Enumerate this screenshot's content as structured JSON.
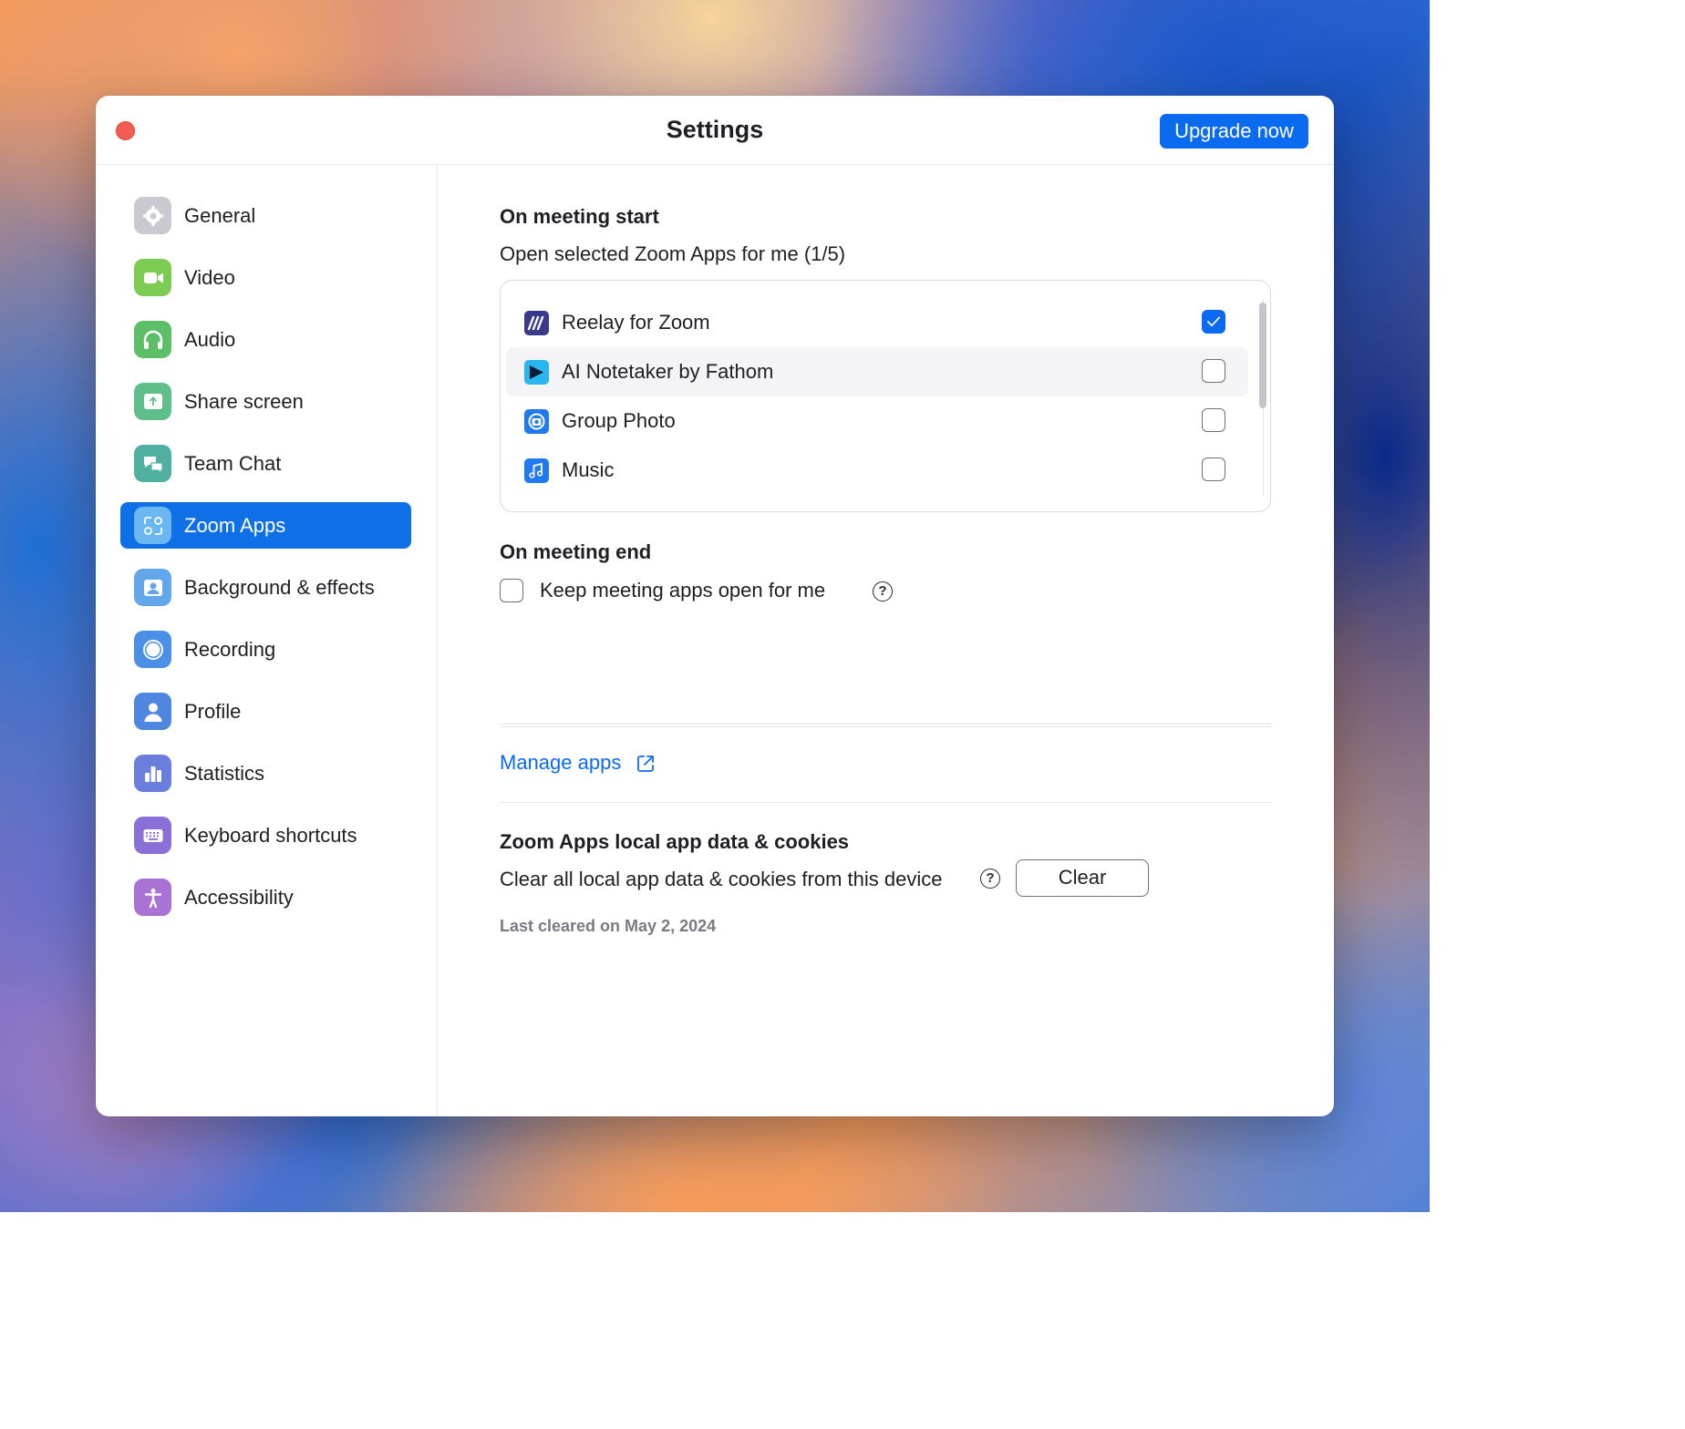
{
  "window": {
    "title": "Settings",
    "upgrade_label": "Upgrade now"
  },
  "sidebar": {
    "items": [
      {
        "label": "General",
        "icon": "gear-icon",
        "color": "#c9c9cf"
      },
      {
        "label": "Video",
        "icon": "video-camera-icon",
        "color": "#7ccb52"
      },
      {
        "label": "Audio",
        "icon": "headphones-icon",
        "color": "#5cbf68"
      },
      {
        "label": "Share screen",
        "icon": "share-screen-icon",
        "color": "#5fbf8a"
      },
      {
        "label": "Team Chat",
        "icon": "chat-bubbles-icon",
        "color": "#4fb0a0"
      },
      {
        "label": "Zoom Apps",
        "icon": "zoom-apps-icon",
        "color": "#6ab7f2"
      },
      {
        "label": "Background & effects",
        "icon": "background-person-icon",
        "color": "#62a7ea"
      },
      {
        "label": "Recording",
        "icon": "record-circle-icon",
        "color": "#4b8fe6"
      },
      {
        "label": "Profile",
        "icon": "person-icon",
        "color": "#4f86e0"
      },
      {
        "label": "Statistics",
        "icon": "bar-chart-icon",
        "color": "#6a7fdb"
      },
      {
        "label": "Keyboard shortcuts",
        "icon": "keyboard-icon",
        "color": "#8a6fd8"
      },
      {
        "label": "Accessibility",
        "icon": "accessibility-icon",
        "color": "#a873d4"
      }
    ],
    "active_index": 5
  },
  "content": {
    "start_heading": "On meeting start",
    "open_apps_text": "Open selected Zoom Apps for me (1/5)",
    "apps": [
      {
        "name": "Reelay for Zoom",
        "icon": "reelay-icon",
        "checked": true
      },
      {
        "name": "AI Notetaker by Fathom",
        "icon": "fathom-icon",
        "checked": false
      },
      {
        "name": "Group Photo",
        "icon": "camera-icon",
        "checked": false
      },
      {
        "name": "Music",
        "icon": "music-note-icon",
        "checked": false
      }
    ],
    "end_heading": "On meeting end",
    "keep_open_label": "Keep meeting apps open for me",
    "keep_open_checked": false,
    "manage_apps_label": "Manage apps",
    "data_heading": "Zoom Apps local app data & cookies",
    "clear_text": "Clear all local app data & cookies from this device",
    "clear_button_label": "Clear",
    "last_cleared": "Last cleared on May 2, 2024",
    "help_glyph": "?"
  },
  "colors": {
    "accent": "#0b6bf0",
    "close_button": "#f45b51",
    "active_nav": "#0e6fe6"
  }
}
